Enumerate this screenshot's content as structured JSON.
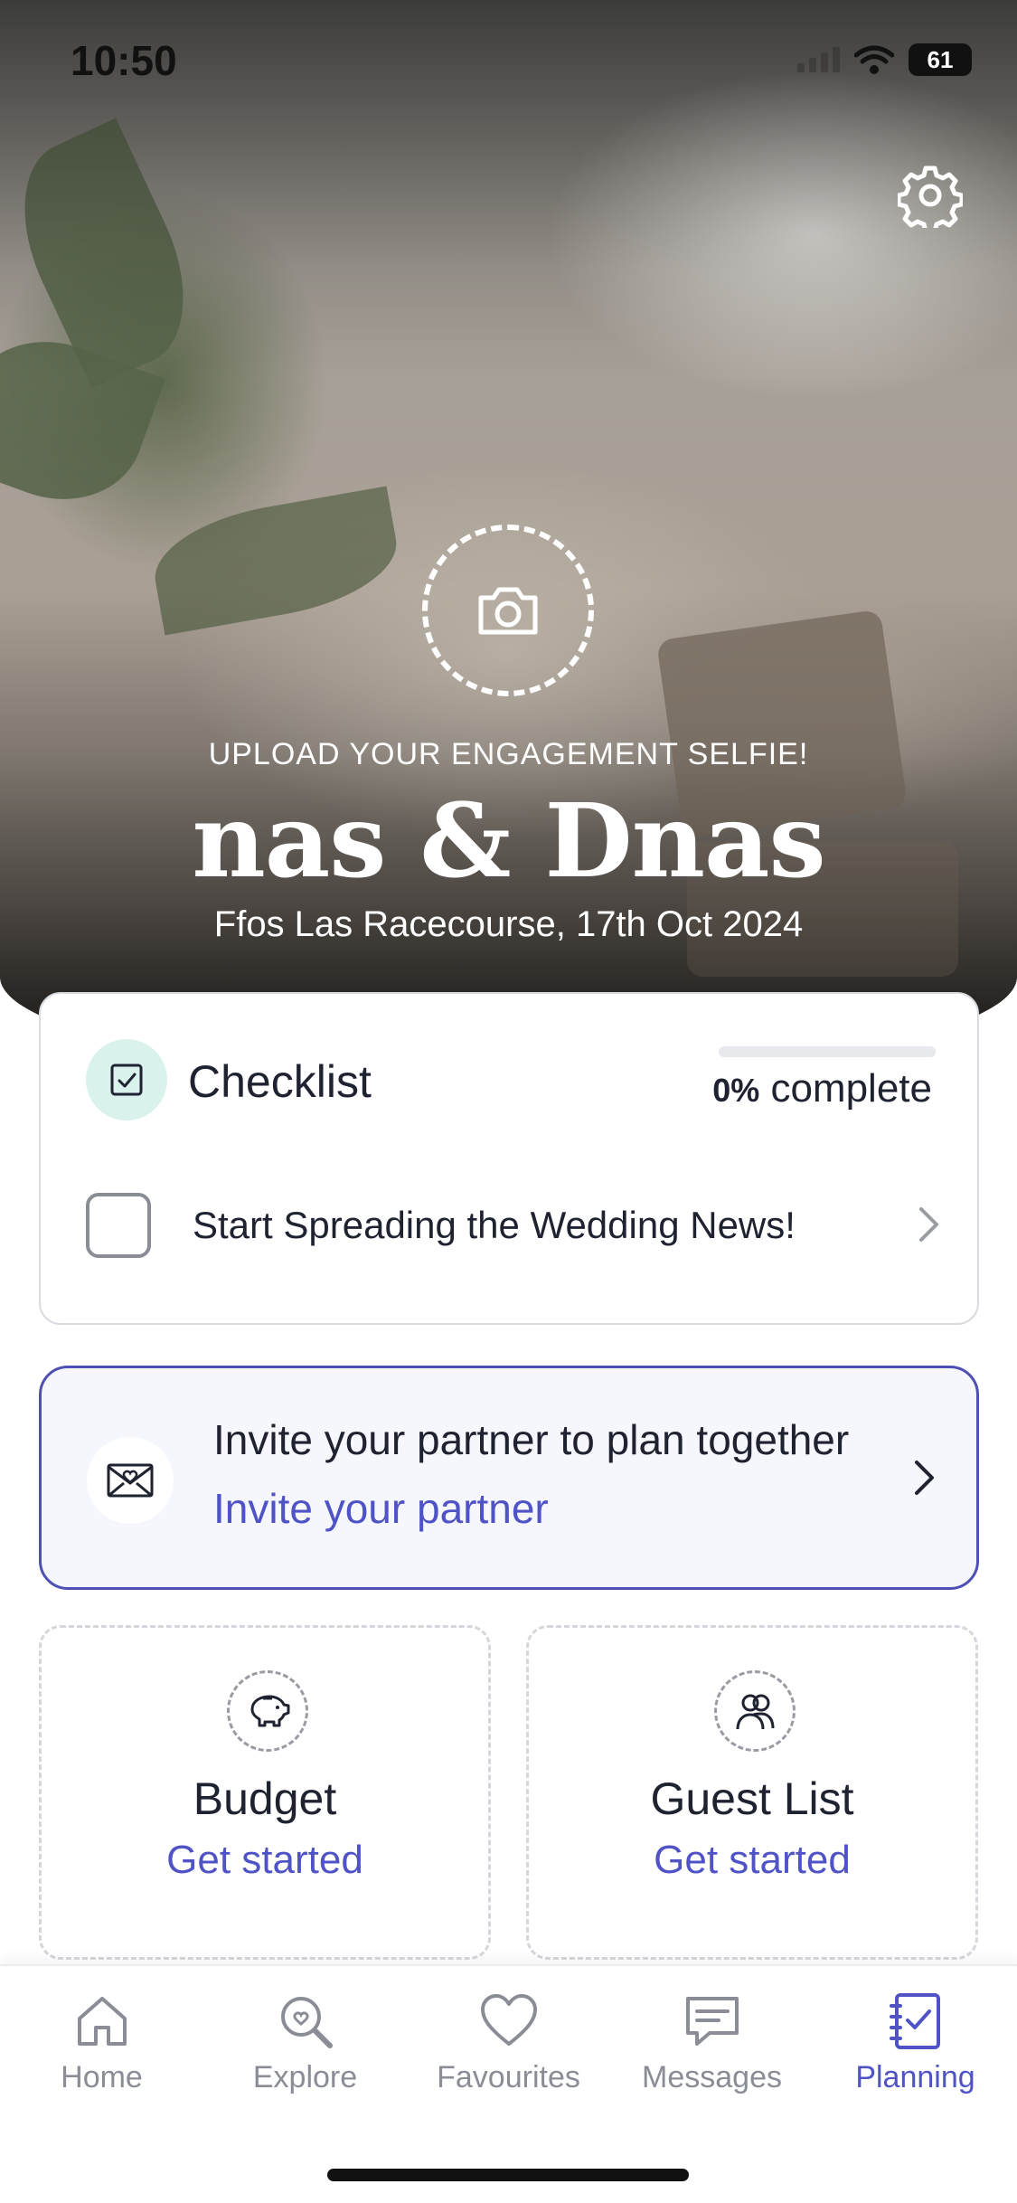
{
  "status_bar": {
    "time": "10:50",
    "battery": "61"
  },
  "hero": {
    "upload_label": "UPLOAD YOUR ENGAGEMENT SELFIE!",
    "couple_names": "nas & Dnas",
    "venue_date": "Ffos Las Racecourse, 17th Oct 2024"
  },
  "checklist": {
    "title": "Checklist",
    "progress_percent": 0,
    "progress_value": "0%",
    "progress_suffix": "complete",
    "task_label": "Start Spreading the Wedding News!"
  },
  "invite": {
    "title": "Invite your partner to plan together",
    "link": "Invite your partner"
  },
  "tiles": [
    {
      "title": "Budget",
      "link": "Get started",
      "icon": "piggy-bank-icon"
    },
    {
      "title": "Guest List",
      "link": "Get started",
      "icon": "people-icon"
    }
  ],
  "tabbar": {
    "items": [
      {
        "label": "Home",
        "icon": "home-icon"
      },
      {
        "label": "Explore",
        "icon": "explore-icon"
      },
      {
        "label": "Favourites",
        "icon": "heart-icon"
      },
      {
        "label": "Messages",
        "icon": "messages-icon"
      },
      {
        "label": "Planning",
        "icon": "planning-icon",
        "active": true
      }
    ]
  },
  "colors": {
    "accent": "#4f53c6",
    "text": "#1f2230",
    "muted": "#8a8d96",
    "check_badge_bg": "#d9f3ec"
  }
}
